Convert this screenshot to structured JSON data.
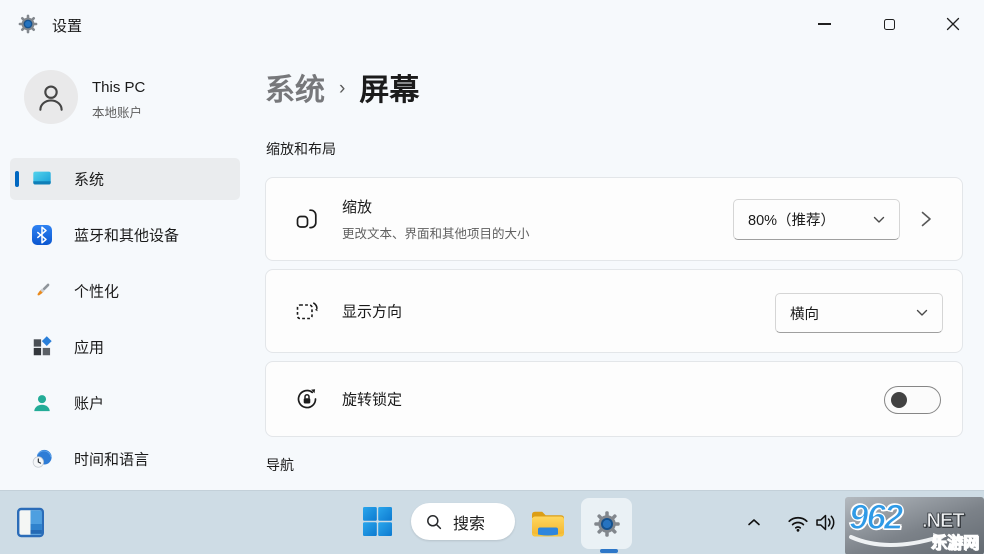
{
  "window": {
    "title": "设置"
  },
  "sidebar": {
    "user": {
      "name": "This PC",
      "account_type": "本地账户"
    },
    "items": [
      {
        "label": "系统",
        "selected": true
      },
      {
        "label": "蓝牙和其他设备",
        "selected": false
      },
      {
        "label": "个性化",
        "selected": false
      },
      {
        "label": "应用",
        "selected": false
      },
      {
        "label": "账户",
        "selected": false
      },
      {
        "label": "时间和语言",
        "selected": false
      }
    ]
  },
  "main": {
    "breadcrumb": {
      "parent": "系统",
      "separator": "›",
      "current": "屏幕"
    },
    "sections": {
      "scale_layout": "缩放和布局",
      "navigation": "导航"
    },
    "cards": {
      "scale": {
        "title": "缩放",
        "subtitle": "更改文本、界面和其他项目的大小",
        "value": "80%（推荐）"
      },
      "orientation": {
        "title": "显示方向",
        "value": "横向"
      },
      "rotation_lock": {
        "title": "旋转锁定",
        "enabled": false
      }
    }
  },
  "taskbar": {
    "search": {
      "label": "搜索"
    },
    "watermark": {
      "number": "962",
      "domain": ".NET",
      "site": "乐游网"
    }
  },
  "colors": {
    "accent": "#0067c0",
    "taskbar_bg": "#cedce5",
    "content_bg": "#f6f9fc",
    "toggle_off_knob": "#424242"
  }
}
